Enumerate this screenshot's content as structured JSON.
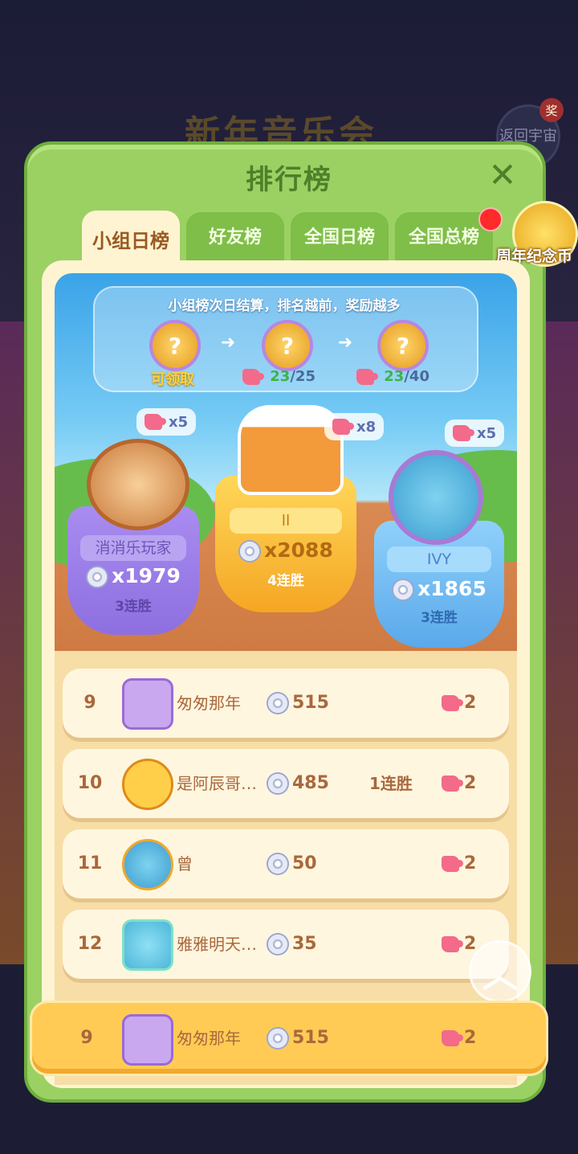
{
  "background": {
    "banner_text": "新年音乐会",
    "return_label": "返回宇宙",
    "award_badge": "奖"
  },
  "panel": {
    "title": "排行榜",
    "close_icon": "close-icon"
  },
  "tabs": [
    {
      "label": "小组日榜",
      "active": true
    },
    {
      "label": "好友榜",
      "active": false
    },
    {
      "label": "全国日榜",
      "active": false
    },
    {
      "label": "全国总榜",
      "active": false
    }
  ],
  "coin_button": {
    "label": "周年纪念币",
    "icon": "coin-icon"
  },
  "rewards_info": {
    "title": "小组榜次日结算，排名越前，奖励越多",
    "items": [
      {
        "icon": "mystery-reward-icon",
        "label": "可领取"
      },
      {
        "icon": "mystery-reward-icon",
        "progress_current": "23",
        "progress_total": "/25"
      },
      {
        "icon": "mystery-reward-icon",
        "progress_current": "23",
        "progress_total": "/40"
      }
    ]
  },
  "podium": {
    "first": {
      "name": "ll",
      "score": "x2088",
      "streak": "4连胜",
      "pieces": "x8"
    },
    "second": {
      "name": "消消乐玩家",
      "score": "x1979",
      "streak": "3连胜",
      "pieces": "x5"
    },
    "third": {
      "name": "IVY",
      "score": "x1865",
      "streak": "3连胜",
      "pieces": "x5"
    }
  },
  "rows": [
    {
      "rank": "9",
      "name": "匆匆那年",
      "score": "515",
      "streak": "",
      "pieces": "2"
    },
    {
      "rank": "10",
      "name": "是阿辰哥…",
      "score": "485",
      "streak": "1连胜",
      "pieces": "2"
    },
    {
      "rank": "11",
      "name": "曾",
      "score": "50",
      "streak": "",
      "pieces": "2"
    },
    {
      "rank": "12",
      "name": "雅雅明天…",
      "score": "35",
      "streak": "",
      "pieces": "2"
    }
  ],
  "my_row": {
    "rank": "9",
    "name": "匆匆那年",
    "score": "515",
    "pieces": "2"
  },
  "colors": {
    "panel": "#9bd163",
    "tab_active": "#fff4d2",
    "my_row": "#ffcb55"
  }
}
